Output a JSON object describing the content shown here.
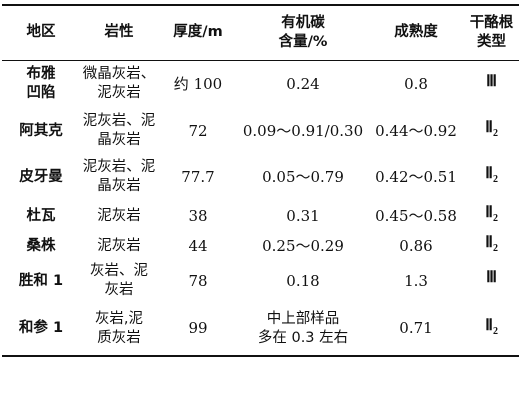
{
  "header_lines": {
    "region": "地区",
    "lithology": "岩性",
    "thickness": "厚度/m",
    "toc_1": "有机碳",
    "toc_2": "含量/%",
    "maturity": "成熟度",
    "kerogen_1": "干酪根",
    "kerogen_2": "类型"
  },
  "rows": [
    {
      "region": [
        "布雅",
        "凹陷"
      ],
      "lithology": [
        "微晶灰岩、",
        "泥灰岩"
      ],
      "thickness": "约 100",
      "toc": [
        "0.24"
      ],
      "maturity": "0.8",
      "kerogen": "Ⅲ",
      "kerogen_sub": ""
    },
    {
      "region": [
        "阿其克"
      ],
      "lithology": [
        "泥灰岩、泥",
        "晶灰岩"
      ],
      "thickness": "72",
      "toc": [
        "0.09～0.91/0.30"
      ],
      "maturity": "0.44～0.92",
      "kerogen": "Ⅱ",
      "kerogen_sub": "2"
    },
    {
      "region": [
        "皮牙曼"
      ],
      "lithology": [
        "泥灰岩、泥",
        "晶灰岩"
      ],
      "thickness": "77.7",
      "toc": [
        "0.05～0.79"
      ],
      "maturity": "0.42～0.51",
      "kerogen": "Ⅱ",
      "kerogen_sub": "2"
    },
    {
      "region": [
        "杜瓦"
      ],
      "lithology": [
        "泥灰岩"
      ],
      "thickness": "38",
      "toc": [
        "0.31"
      ],
      "maturity": "0.45～0.58",
      "kerogen": "Ⅱ",
      "kerogen_sub": "2"
    },
    {
      "region": [
        "桑株"
      ],
      "lithology": [
        "泥灰岩"
      ],
      "thickness": "44",
      "toc": [
        "0.25～0.29"
      ],
      "maturity": "0.86",
      "kerogen": "Ⅱ",
      "kerogen_sub": "2"
    },
    {
      "region": [
        "胜和 1"
      ],
      "lithology": [
        "灰岩、泥",
        "灰岩"
      ],
      "thickness": "78",
      "toc": [
        "0.18"
      ],
      "maturity": "1.3",
      "kerogen": "Ⅲ",
      "kerogen_sub": ""
    },
    {
      "region": [
        "和参 1"
      ],
      "lithology": [
        "灰岩,泥",
        "质灰岩"
      ],
      "thickness": "99",
      "toc": [
        "中上部样品",
        "多在 0.3 左右"
      ],
      "maturity": "0.71",
      "kerogen": "Ⅱ",
      "kerogen_sub": "2"
    }
  ]
}
